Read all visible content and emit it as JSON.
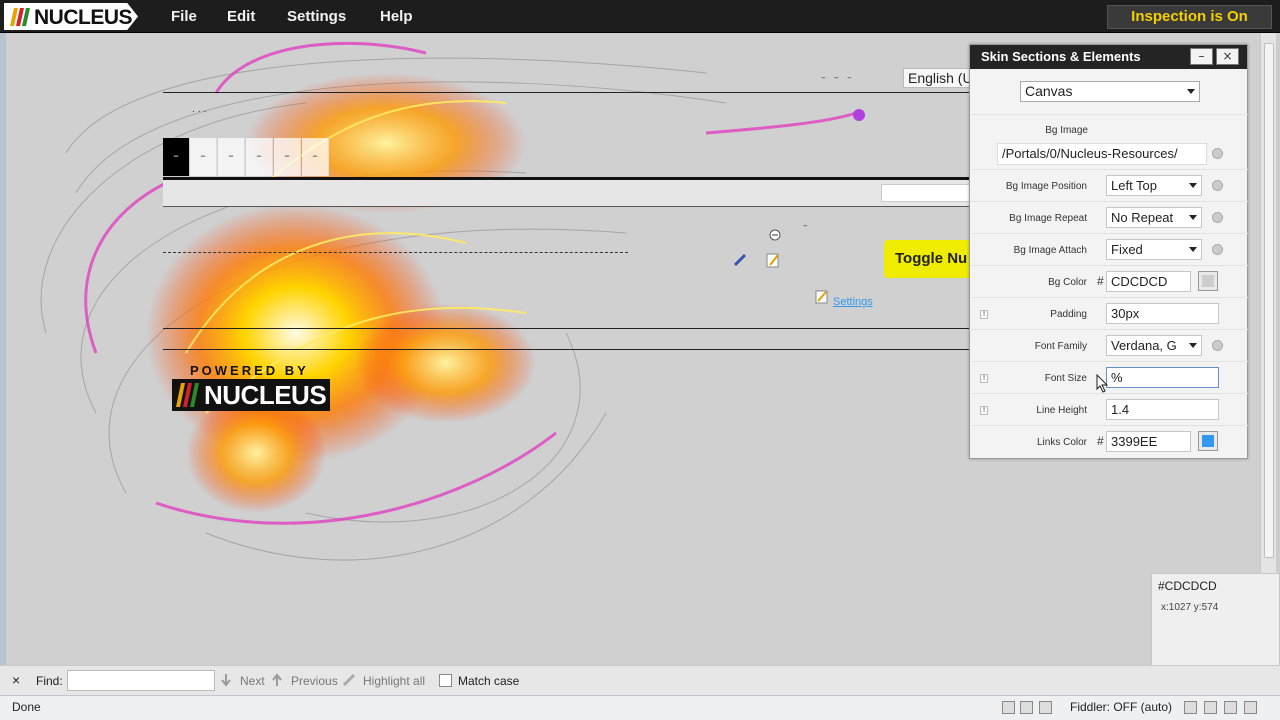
{
  "topbar": {
    "logo": "NUCLEUS",
    "menu": [
      "File",
      "Edit",
      "Settings",
      "Help"
    ],
    "inspection": "Inspection is On"
  },
  "page": {
    "language": "English (U",
    "toggle_label": "Toggle Nu",
    "settings_link": "Settings",
    "powered_top": "POWERED BY",
    "powered_logo": "NUCLEUS"
  },
  "panel": {
    "title": "Skin Sections & Elements",
    "minimize": "–",
    "close": "×",
    "section": "Canvas",
    "bg_image": {
      "label": "Bg Image",
      "value": "/Portals/0/Nucleus-Resources/"
    },
    "bg_image_position": {
      "label": "Bg Image Position",
      "value": "Left Top"
    },
    "bg_image_repeat": {
      "label": "Bg Image Repeat",
      "value": "No Repeat"
    },
    "bg_image_attach": {
      "label": "Bg Image Attach",
      "value": "Fixed"
    },
    "bg_color": {
      "label": "Bg Color",
      "hash": "#",
      "value": "CDCDCD",
      "swatch": "#CDCDCD"
    },
    "padding": {
      "label": "Padding",
      "value": "30px"
    },
    "font_family": {
      "label": "Font Family",
      "value": "Verdana, G"
    },
    "font_size": {
      "label": "Font Size",
      "value": "%"
    },
    "line_height": {
      "label": "Line Height",
      "value": "1.4"
    },
    "links_color": {
      "label": "Links Color",
      "hash": "#",
      "value": "3399EE",
      "swatch": "#3399EE"
    }
  },
  "tooltip": {
    "color": "#CDCDCD",
    "coords": "x:1027 y:574"
  },
  "findbar": {
    "close": "×",
    "find_label": "Find:",
    "next": "Next",
    "previous": "Previous",
    "highlight": "Highlight all",
    "match_case": "Match case"
  },
  "statusbar": {
    "status": "Done",
    "fiddler": "Fiddler: OFF (auto)"
  }
}
